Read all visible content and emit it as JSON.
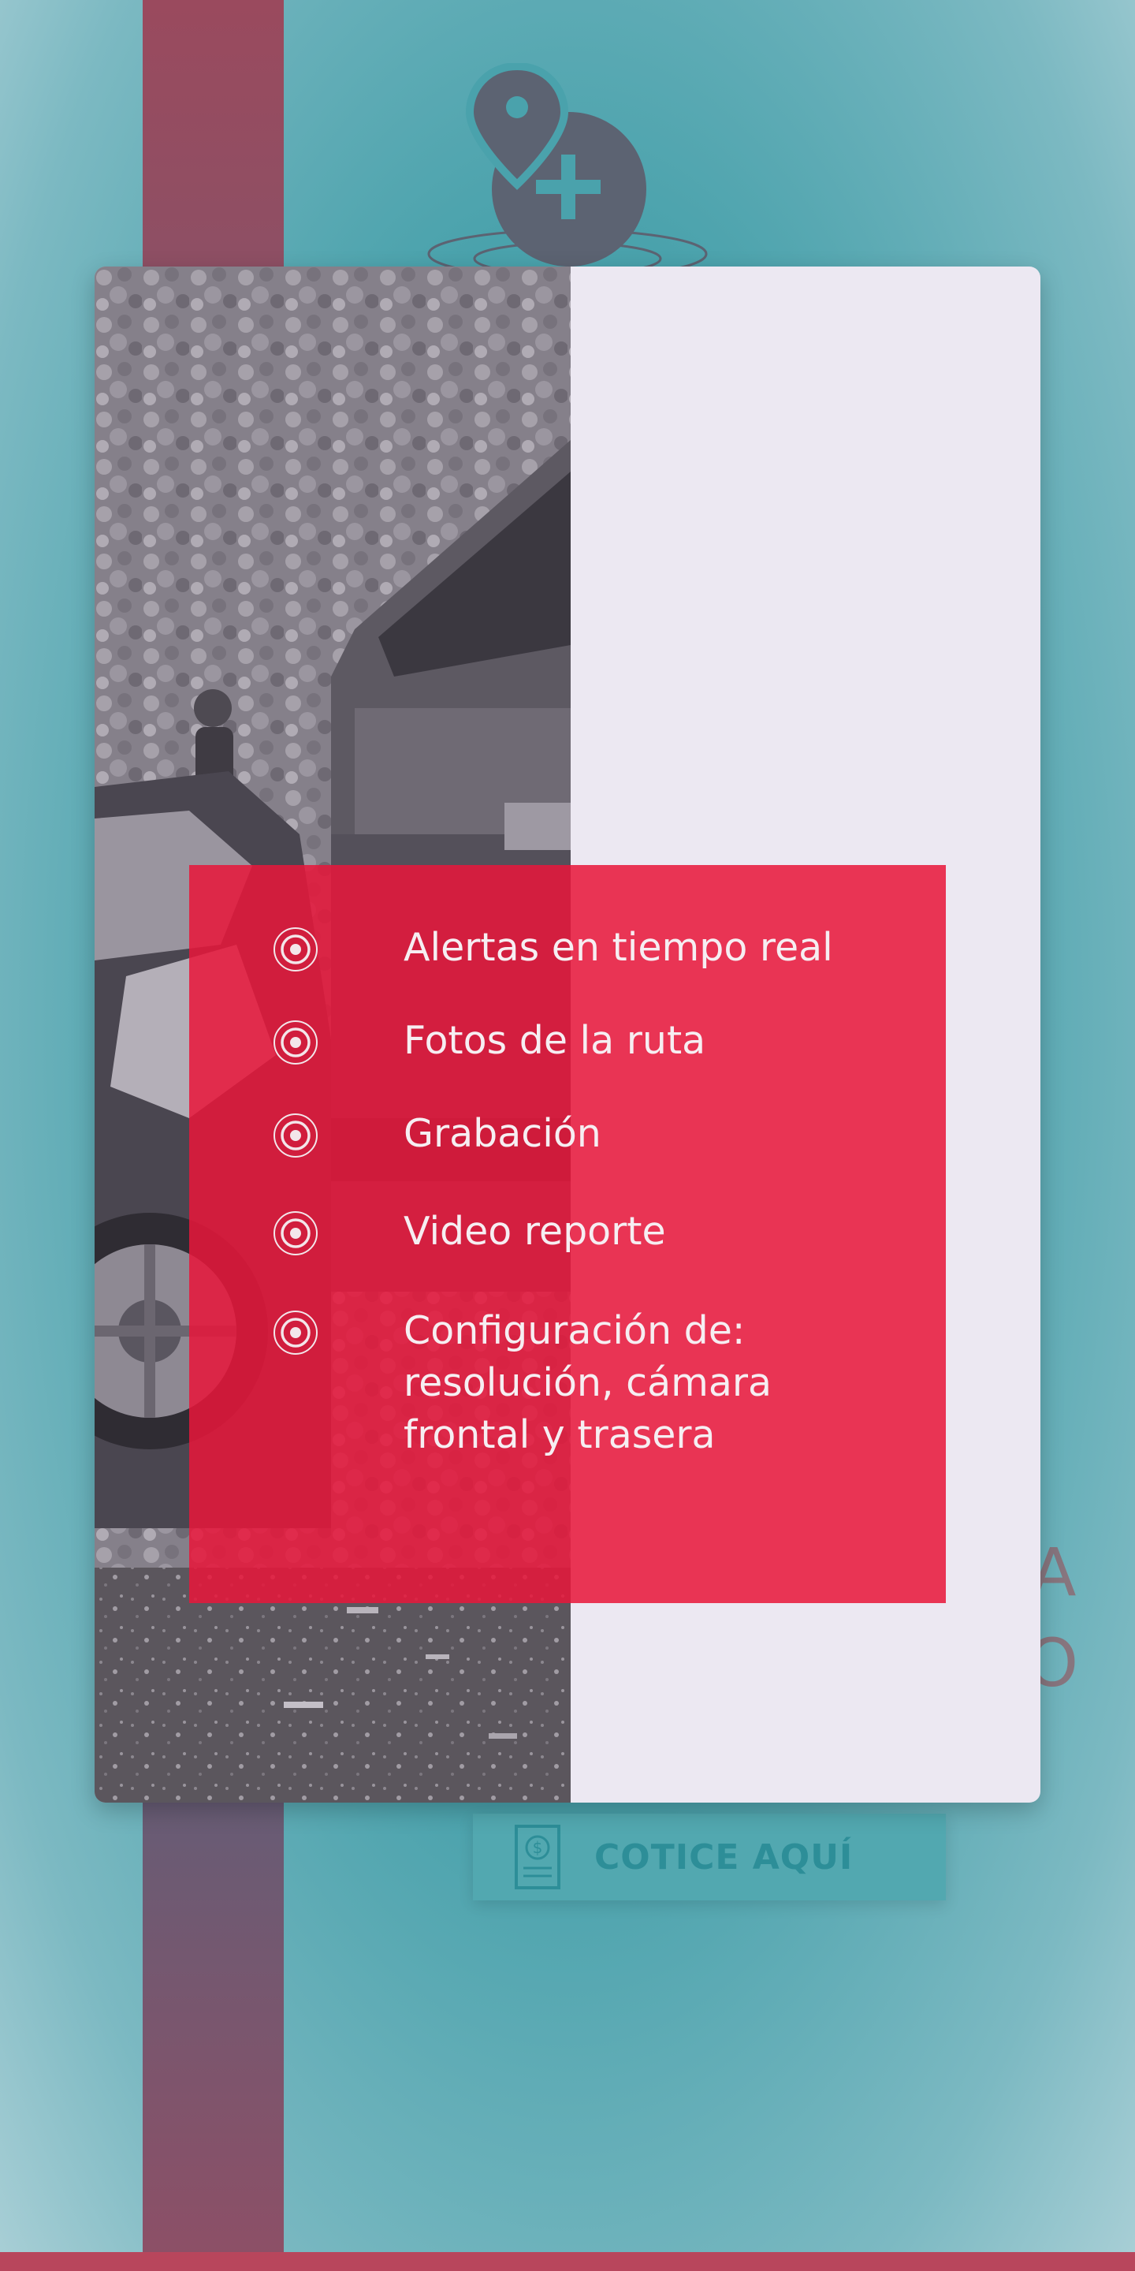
{
  "logo": {
    "icon": "map-pin-plus-icon"
  },
  "background": {
    "peek_glyphs": [
      "A",
      "O"
    ]
  },
  "cotice_button": {
    "label": "COTICE AQUÍ",
    "icon": "quote-document-icon"
  },
  "modal": {
    "photo": {
      "description": "car crash grayscale photo"
    },
    "features": [
      {
        "icon": "radio-target-icon",
        "label": "Alertas en tiempo real"
      },
      {
        "icon": "radio-target-icon",
        "label": "Fotos de la ruta"
      },
      {
        "icon": "radio-target-icon",
        "label": "Grabación"
      },
      {
        "icon": "radio-target-icon",
        "label": "Video reporte"
      },
      {
        "icon": "radio-target-icon",
        "label": "Configuración de: resolución, cámara frontal y trasera"
      }
    ]
  },
  "colors": {
    "accent_red": "#E8163A",
    "teal": "#4AA2AC",
    "modal_bg": "#ECE8F2"
  }
}
